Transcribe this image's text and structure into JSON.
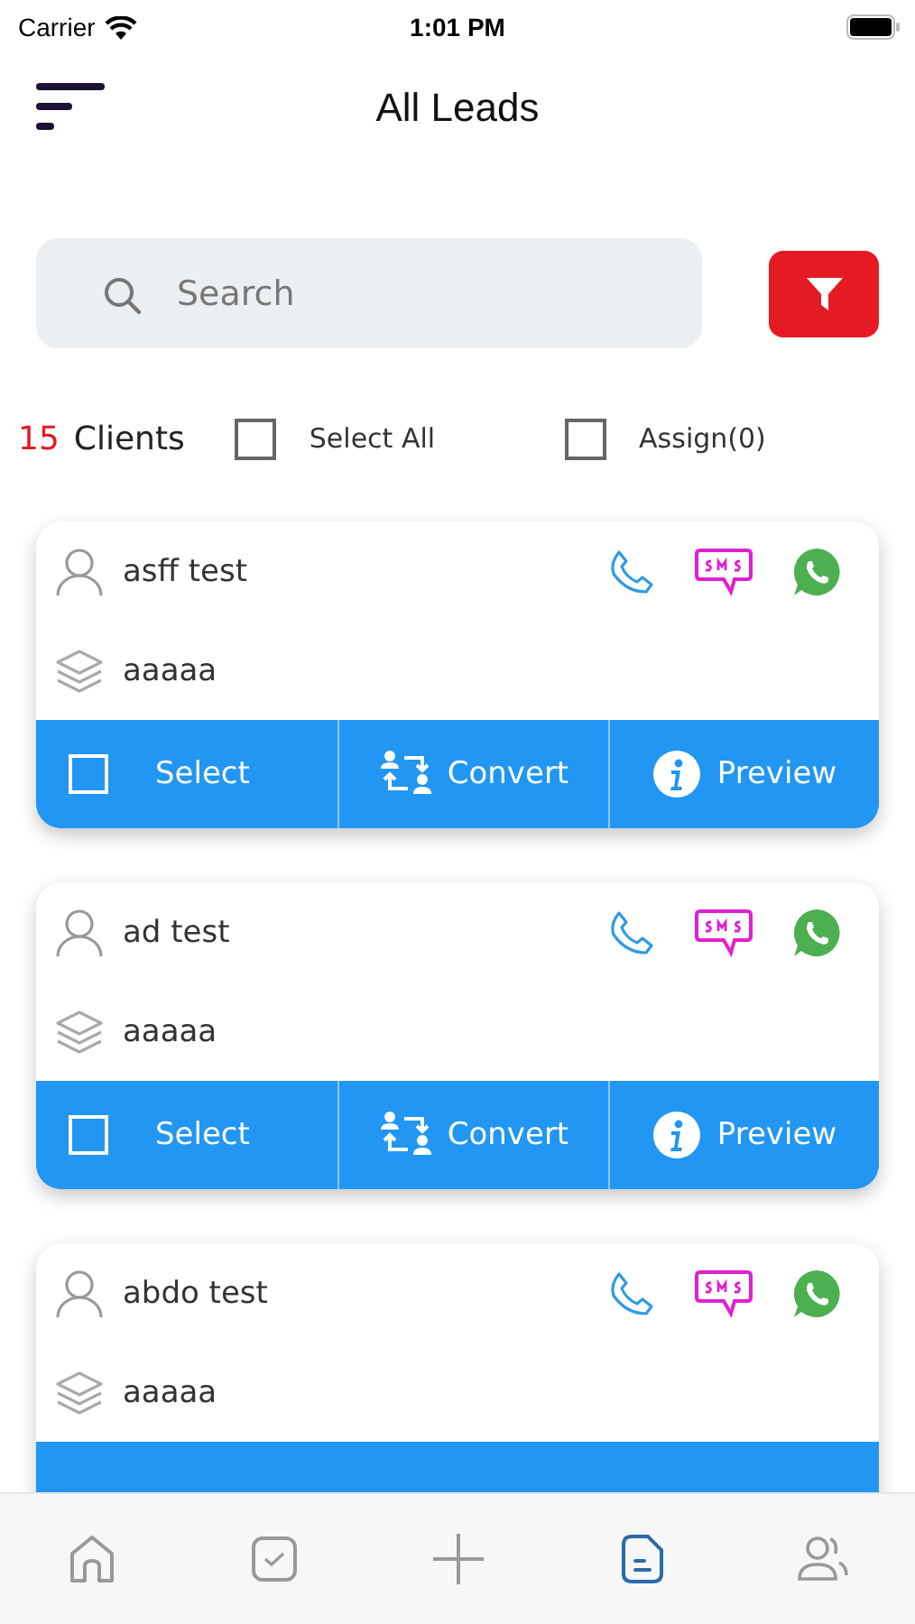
{
  "status_bar": {
    "carrier": "Carrier",
    "time": "1:01 PM"
  },
  "header": {
    "title": "All Leads"
  },
  "search": {
    "placeholder": "Search"
  },
  "summary": {
    "count": "15",
    "label": "Clients",
    "select_all": {
      "label": "Select All",
      "checked": false
    },
    "assign": {
      "label": "Assign(0)",
      "checked": false
    }
  },
  "cards": [
    {
      "name": "asff test",
      "group": "aaaaa",
      "actions": [
        {
          "kind": "select",
          "label": "Select",
          "checked": false
        },
        {
          "kind": "convert",
          "label": "Convert"
        },
        {
          "kind": "preview",
          "label": "Preview"
        }
      ]
    },
    {
      "name": "ad test",
      "group": "aaaaa",
      "actions": [
        {
          "kind": "select",
          "label": "Select",
          "checked": false
        },
        {
          "kind": "convert",
          "label": "Convert"
        },
        {
          "kind": "preview",
          "label": "Preview"
        }
      ]
    },
    {
      "name": "abdo test",
      "group": "aaaaa"
    }
  ],
  "tab_bar": [
    {
      "kind": "home",
      "selected": false
    },
    {
      "kind": "tasks",
      "selected": false
    },
    {
      "kind": "add",
      "selected": false
    },
    {
      "kind": "leads",
      "selected": true
    },
    {
      "kind": "contacts",
      "selected": false
    }
  ]
}
